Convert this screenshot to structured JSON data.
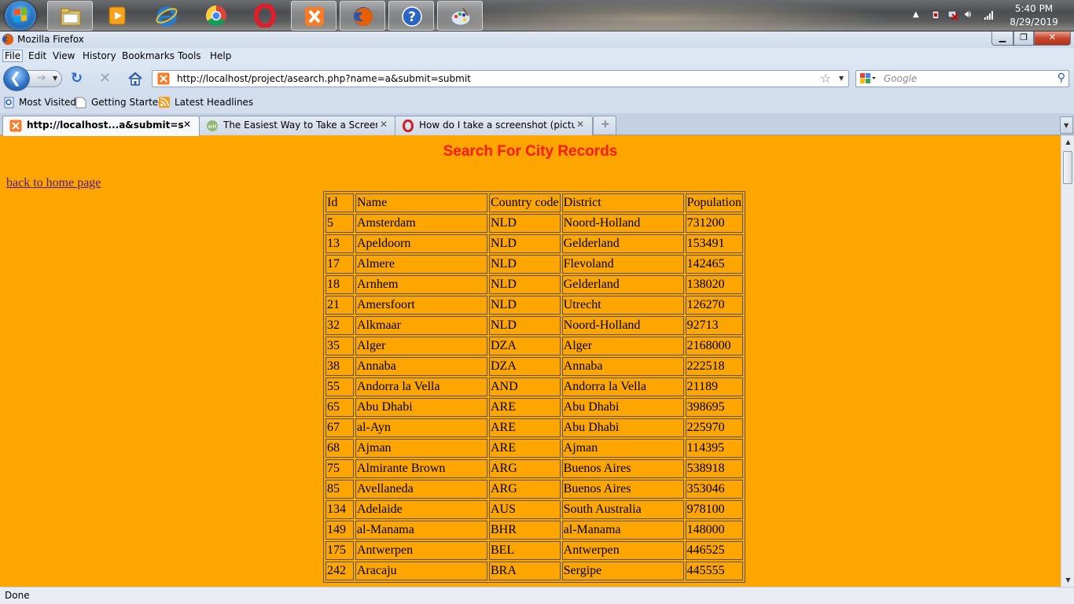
{
  "taskbar": {
    "items": [
      {
        "name": "windows-explorer"
      },
      {
        "name": "media-player"
      },
      {
        "name": "internet-explorer"
      },
      {
        "name": "chrome"
      },
      {
        "name": "opera"
      },
      {
        "name": "xampp"
      },
      {
        "name": "firefox"
      },
      {
        "name": "help"
      },
      {
        "name": "paint"
      }
    ],
    "clock": {
      "time": "5:40 PM",
      "date": "8/29/2019"
    }
  },
  "window": {
    "title": "Mozilla Firefox"
  },
  "menu": {
    "file": "File",
    "edit": "Edit",
    "view": "View",
    "history": "History",
    "bookmarks": "Bookmarks",
    "tools": "Tools",
    "help": "Help"
  },
  "nav": {
    "url": "http://localhost/project/asearch.php?name=a&submit=submit",
    "search_placeholder": "Google"
  },
  "bookmarks": {
    "most_visited": "Most Visited",
    "getting_started": "Getting Started",
    "latest_headlines": "Latest Headlines"
  },
  "tabs": [
    {
      "label": "http://localhost...a&submit=submit",
      "icon": "xampp-icon"
    },
    {
      "label": "The Easiest Way to Take a Screensh...",
      "icon": "wikihow-icon"
    },
    {
      "label": "How do I take a screenshot (picture ...",
      "icon": "opera-icon"
    }
  ],
  "page": {
    "heading": "Search For City Records",
    "back_link": "back to home page",
    "table": {
      "headers": [
        "Id",
        "Name",
        "Country code",
        "District",
        "Population"
      ],
      "rows": [
        [
          "5",
          "Amsterdam",
          "NLD",
          "Noord-Holland",
          "731200"
        ],
        [
          "13",
          "Apeldoorn",
          "NLD",
          "Gelderland",
          "153491"
        ],
        [
          "17",
          "Almere",
          "NLD",
          "Flevoland",
          "142465"
        ],
        [
          "18",
          "Arnhem",
          "NLD",
          "Gelderland",
          "138020"
        ],
        [
          "21",
          "Amersfoort",
          "NLD",
          "Utrecht",
          "126270"
        ],
        [
          "32",
          "Alkmaar",
          "NLD",
          "Noord-Holland",
          "92713"
        ],
        [
          "35",
          "Alger",
          "DZA",
          "Alger",
          "2168000"
        ],
        [
          "38",
          "Annaba",
          "DZA",
          "Annaba",
          "222518"
        ],
        [
          "55",
          "Andorra la Vella",
          "AND",
          "Andorra la Vella",
          "21189"
        ],
        [
          "65",
          "Abu Dhabi",
          "ARE",
          "Abu Dhabi",
          "398695"
        ],
        [
          "67",
          "al-Ayn",
          "ARE",
          "Abu Dhabi",
          "225970"
        ],
        [
          "68",
          "Ajman",
          "ARE",
          "Ajman",
          "114395"
        ],
        [
          "75",
          "Almirante Brown",
          "ARG",
          "Buenos Aires",
          "538918"
        ],
        [
          "85",
          "Avellaneda",
          "ARG",
          "Buenos Aires",
          "353046"
        ],
        [
          "134",
          "Adelaide",
          "AUS",
          "South Australia",
          "978100"
        ],
        [
          "149",
          "al-Manama",
          "BHR",
          "al-Manama",
          "148000"
        ],
        [
          "175",
          "Antwerpen",
          "BEL",
          "Antwerpen",
          "446525"
        ],
        [
          "242",
          "Aracaju",
          "BRA",
          "Sergipe",
          "445555"
        ]
      ]
    },
    "colors": {
      "background": "#ffa500",
      "heading": "#ff1a00",
      "link": "#551a8b"
    }
  },
  "status": {
    "text": "Done"
  }
}
